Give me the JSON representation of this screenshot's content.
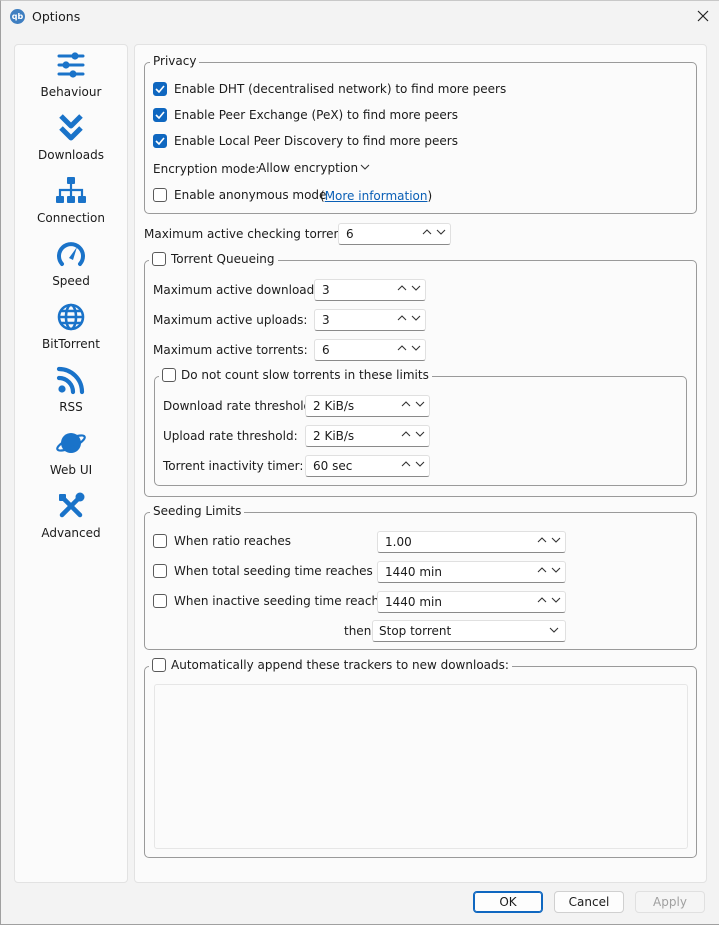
{
  "window": {
    "title": "Options",
    "app_icon_text": "qb"
  },
  "sidebar": {
    "items": [
      {
        "label": "Behaviour",
        "icon": "sliders-icon"
      },
      {
        "label": "Downloads",
        "icon": "double-chevron-down-icon"
      },
      {
        "label": "Connection",
        "icon": "network-icon"
      },
      {
        "label": "Speed",
        "icon": "gauge-icon"
      },
      {
        "label": "BitTorrent",
        "icon": "globe-icon"
      },
      {
        "label": "RSS",
        "icon": "rss-icon"
      },
      {
        "label": "Web UI",
        "icon": "planet-icon"
      },
      {
        "label": "Advanced",
        "icon": "tools-icon"
      }
    ]
  },
  "privacy": {
    "title": "Privacy",
    "dht": {
      "label": "Enable DHT (decentralised network) to find more peers",
      "checked": true
    },
    "pex": {
      "label": "Enable Peer Exchange (PeX) to find more peers",
      "checked": true
    },
    "lpd": {
      "label": "Enable Local Peer Discovery to find more peers",
      "checked": true
    },
    "encryption_label": "Encryption mode:",
    "encryption_value": "Allow encryption",
    "anon": {
      "label": "Enable anonymous mode",
      "checked": false
    },
    "more_info_open": "(",
    "more_info": "More information",
    "more_info_close": ")"
  },
  "checking": {
    "label": "Maximum active checking torrents:",
    "value": "6"
  },
  "queueing": {
    "title": "Torrent Queueing",
    "checked": false,
    "downloads_label": "Maximum active downloads:",
    "downloads_value": "3",
    "uploads_label": "Maximum active uploads:",
    "uploads_value": "3",
    "torrents_label": "Maximum active torrents:",
    "torrents_value": "6",
    "slow": {
      "title": "Do not count slow torrents in these limits",
      "checked": false,
      "download_label": "Download rate threshold:",
      "download_value": "2 KiB/s",
      "upload_label": "Upload rate threshold:",
      "upload_value": "2 KiB/s",
      "inactivity_label": "Torrent inactivity timer:",
      "inactivity_value": "60 sec"
    }
  },
  "seeding": {
    "title": "Seeding Limits",
    "ratio_label": "When ratio reaches",
    "ratio_value": "1.00",
    "total_label": "When total seeding time reaches",
    "total_value": "1440 min",
    "inactive_label": "When inactive seeding time reaches",
    "inactive_value": "1440 min",
    "then_label": "then",
    "then_value": "Stop torrent"
  },
  "trackers": {
    "label": "Automatically append these trackers to new downloads:",
    "checked": false,
    "text": ""
  },
  "buttons": {
    "ok": "OK",
    "cancel": "Cancel",
    "apply": "Apply"
  },
  "colors": {
    "accent": "#0f67c0",
    "icon_blue": "#1a73c9"
  }
}
